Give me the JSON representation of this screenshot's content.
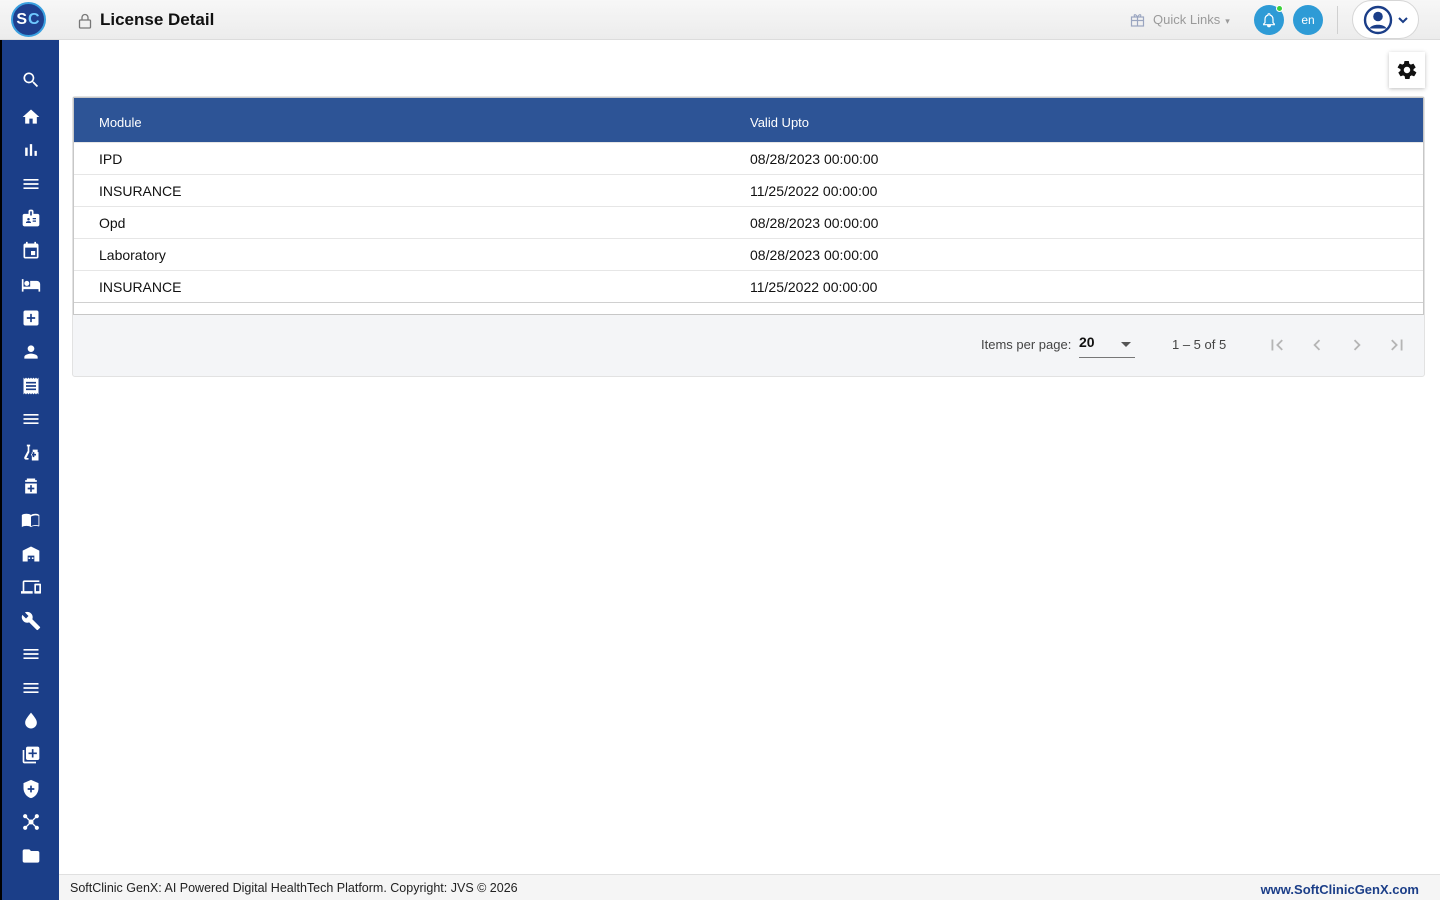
{
  "header": {
    "logo_text": "SC",
    "title": "License Detail",
    "quick_links_label": "Quick Links",
    "language": "en"
  },
  "sidebar": {
    "items": [
      {
        "icon": "search-icon"
      },
      {
        "icon": "home-icon"
      },
      {
        "icon": "bar-chart-icon"
      },
      {
        "icon": "menu-icon"
      },
      {
        "icon": "badge-icon"
      },
      {
        "icon": "calendar-icon"
      },
      {
        "icon": "bed-icon"
      },
      {
        "icon": "medical-plus-icon"
      },
      {
        "icon": "person-icon"
      },
      {
        "icon": "receipt-icon"
      },
      {
        "icon": "menu-icon"
      },
      {
        "icon": "lab-icon"
      },
      {
        "icon": "medicine-icon"
      },
      {
        "icon": "book-icon"
      },
      {
        "icon": "store-icon"
      },
      {
        "icon": "devices-icon"
      },
      {
        "icon": "wrench-icon"
      },
      {
        "icon": "menu-icon"
      },
      {
        "icon": "menu-icon"
      },
      {
        "icon": "blood-drop-icon"
      },
      {
        "icon": "add-library-icon"
      },
      {
        "icon": "shield-plus-icon"
      },
      {
        "icon": "network-icon"
      },
      {
        "icon": "folder-icon"
      }
    ]
  },
  "table": {
    "columns": [
      "Module",
      "Valid Upto"
    ],
    "rows": [
      {
        "module": "IPD",
        "valid_upto": "08/28/2023 00:00:00"
      },
      {
        "module": "INSURANCE",
        "valid_upto": "11/25/2022 00:00:00"
      },
      {
        "module": "Opd",
        "valid_upto": "08/28/2023 00:00:00"
      },
      {
        "module": "Laboratory",
        "valid_upto": "08/28/2023 00:00:00"
      },
      {
        "module": "INSURANCE",
        "valid_upto": "11/25/2022 00:00:00"
      }
    ]
  },
  "paginator": {
    "items_per_page_label": "Items per page:",
    "items_per_page": "20",
    "range_label": "1 – 5 of 5"
  },
  "footer": {
    "copyright": "SoftClinic GenX: AI Powered Digital HealthTech Platform. Copyright: JVS © 2026",
    "link": "www.SoftClinicGenX.com"
  },
  "colors": {
    "sidebar": "#1b3e88",
    "table_header": "#2d5496",
    "accent_button": "#2e9bd6"
  }
}
